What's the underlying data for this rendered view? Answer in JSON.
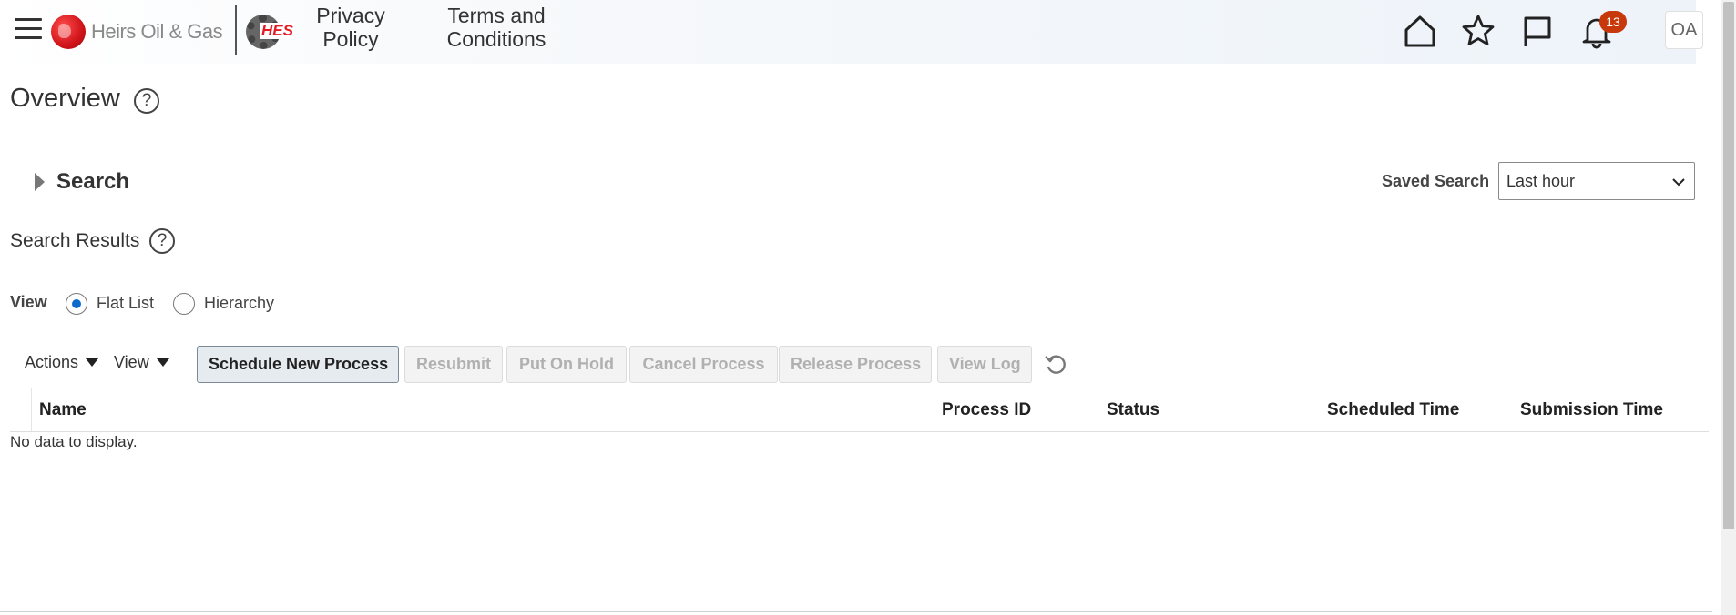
{
  "header": {
    "brand_heirs": "Heirs Oil & Gas",
    "brand_hes": "HES",
    "links": [
      {
        "label_line1": "Privacy",
        "label_line2": "Policy"
      },
      {
        "label_line1": "Terms and",
        "label_line2": "Conditions"
      }
    ],
    "icons": [
      "menu-icon",
      "home-icon",
      "star-icon",
      "flag-icon",
      "bell-icon"
    ],
    "notification_count": "13",
    "user_initials": "OA",
    "badge_color": "#c7390a"
  },
  "page": {
    "title": "Overview",
    "help_glyph": "?"
  },
  "search": {
    "label": "Search",
    "saved_search_label": "Saved Search",
    "saved_search_value": "Last hour"
  },
  "results": {
    "title": "Search Results",
    "view_label": "View",
    "view_options": [
      "Flat List",
      "Hierarchy"
    ],
    "selected_view": "Flat List"
  },
  "toolbar": {
    "actions_label": "Actions",
    "view_label": "View",
    "buttons": [
      {
        "label": "Schedule New Process",
        "enabled": true
      },
      {
        "label": "Resubmit",
        "enabled": false
      },
      {
        "label": "Put On Hold",
        "enabled": false
      },
      {
        "label": "Cancel Process",
        "enabled": false
      },
      {
        "label": "Release Process",
        "enabled": false
      },
      {
        "label": "View Log",
        "enabled": false
      }
    ]
  },
  "table": {
    "columns": [
      "Name",
      "Process ID",
      "Status",
      "Scheduled Time",
      "Submission Time"
    ],
    "rows": [],
    "empty_message": "No data to display."
  },
  "colors": {
    "accent_blue": "#0b6bcb",
    "brand_red": "#e31b23"
  }
}
